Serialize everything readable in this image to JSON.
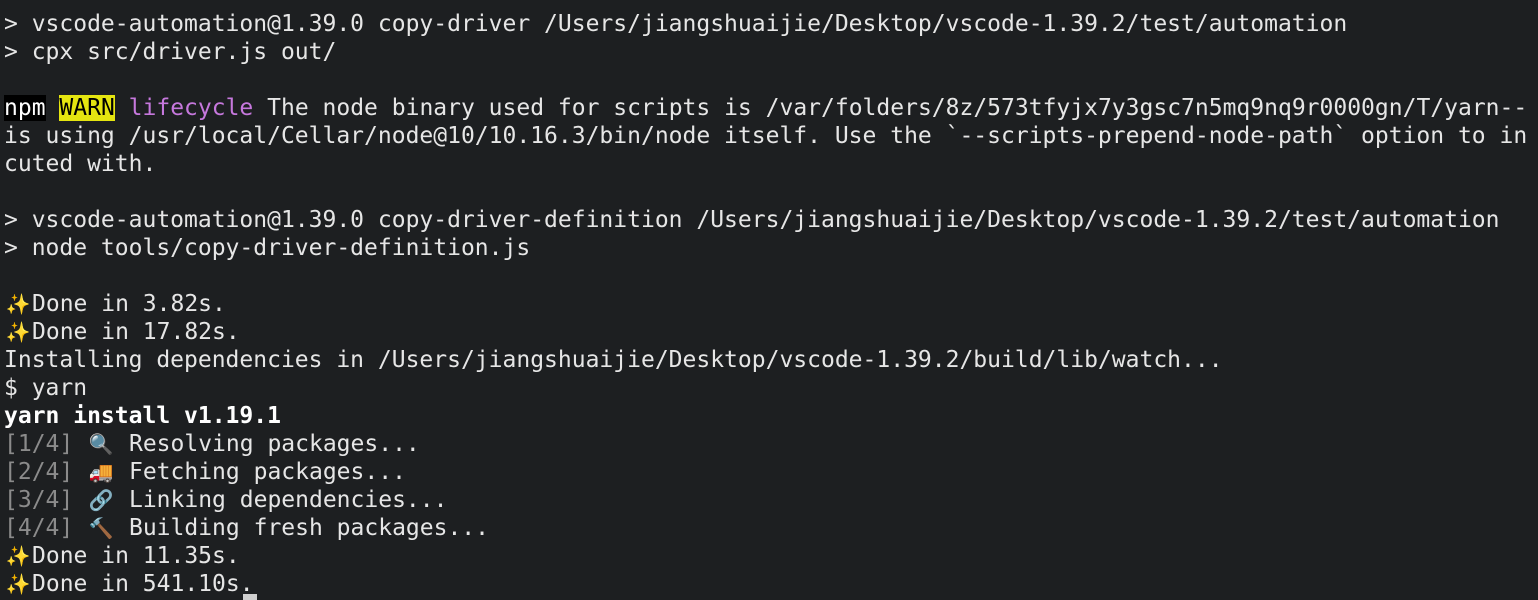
{
  "colors": {
    "background": "#1d1f21",
    "text": "#e6e6e6",
    "npm_bg": "#000000",
    "warn_bg": "#e5e510",
    "lifecycle": "#c678dd",
    "dim": "#8b8b8b"
  },
  "lines": {
    "l1": "> vscode-automation@1.39.0 copy-driver /Users/jiangshuaijie/Desktop/vscode-1.39.2/test/automation",
    "l2": "> cpx src/driver.js out/",
    "warn": {
      "npm": "npm",
      "warn": "WARN",
      "lifecycle": "lifecycle",
      "message": " The node binary used for scripts is /var/folders/8z/573tfyjx7y3gsc7n5mq9nq9r0000gn/T/yarn--"
    },
    "l5": "is using /usr/local/Cellar/node@10/10.16.3/bin/node itself. Use the `--scripts-prepend-node-path` option to in",
    "l6": "cuted with.",
    "l8": "> vscode-automation@1.39.0 copy-driver-definition /Users/jiangshuaijie/Desktop/vscode-1.39.2/test/automation",
    "l9": "> node tools/copy-driver-definition.js",
    "done1": "Done in 3.82s.",
    "done2": "Done in 17.82s.",
    "installing": "Installing dependencies in /Users/jiangshuaijie/Desktop/vscode-1.39.2/build/lib/watch...",
    "yarn_cmd": "$ yarn",
    "yarn_install": "yarn install v1.19.1",
    "step1": {
      "step": "[1/4]",
      "icon": "🔍",
      "text": "Resolving packages..."
    },
    "step2": {
      "step": "[2/4]",
      "icon": "🚚",
      "text": "Fetching packages..."
    },
    "step3": {
      "step": "[3/4]",
      "icon": "🔗",
      "text": "Linking dependencies..."
    },
    "step4": {
      "step": "[4/4]",
      "icon": "🔨",
      "text": "Building fresh packages..."
    },
    "done3": "Done in 11.35s.",
    "done4": "Done in 541.10s.",
    "sparkle": "✨"
  }
}
